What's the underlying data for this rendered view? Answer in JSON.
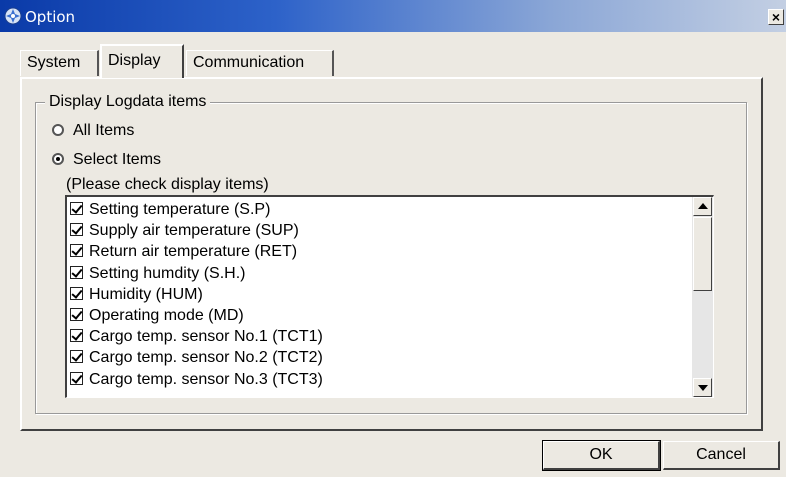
{
  "window": {
    "title": "Option",
    "close_label": "×"
  },
  "tabs": [
    {
      "label": "System"
    },
    {
      "label": "Display"
    },
    {
      "label": "Communication"
    }
  ],
  "group": {
    "legend": "Display Logdata items",
    "radio_all": "All Items",
    "radio_select": "Select Items",
    "hint": "(Please check display items)"
  },
  "items": [
    "Setting temperature (S.P)",
    "Supply air temperature (SUP)",
    "Return air temperature (RET)",
    "Setting humdity (S.H.)",
    "Humidity (HUM)",
    "Operating mode (MD)",
    "Cargo temp. sensor No.1 (TCT1)",
    "Cargo temp. sensor No.2 (TCT2)",
    "Cargo temp. sensor No.3 (TCT3)"
  ],
  "buttons": {
    "ok": "OK",
    "cancel": "Cancel"
  }
}
